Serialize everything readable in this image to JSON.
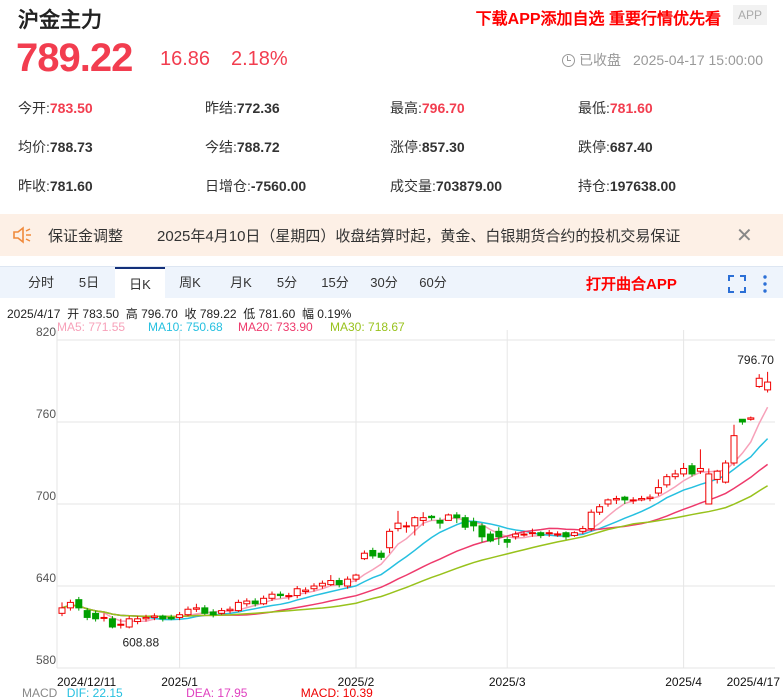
{
  "header": {
    "title": "沪金主力",
    "promo": "下载APP添加自选 重要行情优先看",
    "app_badge": "APP"
  },
  "quote": {
    "price": "789.22",
    "change": "16.86",
    "change_pct": "2.18%",
    "status": "已收盘",
    "datetime": "2025-04-17 15:00:00"
  },
  "stats": [
    [
      {
        "label": "今开:",
        "value": "783.50",
        "red": true
      },
      {
        "label": "昨结:",
        "value": "772.36"
      },
      {
        "label": "最高:",
        "value": "796.70",
        "red": true
      },
      {
        "label": "最低:",
        "value": "781.60",
        "red": true
      }
    ],
    [
      {
        "label": "均价:",
        "value": "788.73"
      },
      {
        "label": "今结:",
        "value": "788.72"
      },
      {
        "label": "涨停:",
        "value": "857.30"
      },
      {
        "label": "跌停:",
        "value": "687.40"
      }
    ],
    [
      {
        "label": "昨收:",
        "value": "781.60"
      },
      {
        "label": "日增仓:",
        "value": "-7560.00"
      },
      {
        "label": "成交量:",
        "value": "703879.00"
      },
      {
        "label": "持仓:",
        "value": "197638.00"
      }
    ]
  ],
  "notice": {
    "title": "保证金调整",
    "text": "2025年4月10日（星期四）收盘结算时起，黄金、白银期货合约的投机交易保证"
  },
  "tabs": [
    "分时",
    "5日",
    "日K",
    "周K",
    "月K",
    "5分",
    "15分",
    "30分",
    "60分"
  ],
  "active_tab": 2,
  "open_app": "打开曲合APP",
  "ohlc_info": {
    "date": "2025/4/17",
    "open": "开 783.50",
    "high": "高 796.70",
    "close": "收 789.22",
    "low": "低 781.60",
    "amp": "幅 0.19%"
  },
  "ma_info": {
    "ma5": "MA5: 771.55",
    "ma10": "MA10: 750.68",
    "ma20": "MA20: 733.90",
    "ma30": "MA30: 718.67"
  },
  "macd_info": {
    "label": "MACD",
    "dif": "DIF: 22.15",
    "dea": "DEA: 17.95",
    "macd": "MACD: 10.39"
  },
  "colors": {
    "up": "#f00000",
    "down": "#00a000",
    "ma5": "#f7a1b9",
    "ma10": "#26c0e0",
    "ma20": "#ee3a6c",
    "ma30": "#98c21c"
  },
  "chart_data": {
    "type": "candlestick",
    "ylim": [
      580,
      820
    ],
    "yticks": [
      "820",
      "760",
      "700",
      "640",
      "580"
    ],
    "xticks": [
      {
        "i": 0,
        "label": "2024/12/11"
      },
      {
        "i": 14,
        "label": "2025/1"
      },
      {
        "i": 35,
        "label": "2025/2"
      },
      {
        "i": 53,
        "label": "2025/3"
      },
      {
        "i": 74,
        "label": "2025/4"
      },
      {
        "i": 84,
        "label": "2025/4/17"
      }
    ],
    "max_label": "796.70",
    "min_label": "608.88",
    "candles": [
      [
        620,
        624,
        628,
        618
      ],
      [
        624,
        628,
        630,
        622
      ],
      [
        630,
        624,
        632,
        622
      ],
      [
        622,
        617,
        624,
        615
      ],
      [
        620,
        616,
        622,
        614
      ],
      [
        617,
        617,
        620,
        614
      ],
      [
        616,
        610,
        618,
        609
      ],
      [
        612,
        612,
        616,
        608.88
      ],
      [
        610,
        616,
        618,
        609
      ],
      [
        614,
        616,
        618,
        612
      ],
      [
        616,
        617,
        619,
        614
      ],
      [
        617,
        618,
        620,
        615
      ],
      [
        618,
        616,
        619,
        614
      ],
      [
        617,
        616,
        619,
        615
      ],
      [
        617,
        619,
        621,
        615
      ],
      [
        619,
        623,
        625,
        618
      ],
      [
        623,
        624,
        627,
        621
      ],
      [
        624,
        620,
        626,
        619
      ],
      [
        621,
        619,
        623,
        617
      ],
      [
        620,
        622,
        624,
        619
      ],
      [
        622,
        623,
        625,
        620
      ],
      [
        622,
        628,
        630,
        621
      ],
      [
        627,
        629,
        631,
        625
      ],
      [
        629,
        627,
        631,
        625
      ],
      [
        627,
        631,
        633,
        626
      ],
      [
        631,
        634,
        636,
        629
      ],
      [
        634,
        633,
        636,
        631
      ],
      [
        633,
        633,
        635,
        630
      ],
      [
        633,
        638,
        640,
        631
      ],
      [
        636,
        637,
        639,
        634
      ],
      [
        638,
        640,
        642,
        636
      ],
      [
        640,
        642,
        644,
        638
      ],
      [
        641,
        644,
        648,
        640
      ],
      [
        644,
        641,
        646,
        639
      ],
      [
        640,
        645,
        647,
        638
      ],
      [
        645,
        648,
        649,
        643
      ],
      [
        660,
        664,
        666,
        659
      ],
      [
        666,
        662,
        668,
        660
      ],
      [
        664,
        661,
        666,
        659
      ],
      [
        668,
        680,
        682,
        664
      ],
      [
        682,
        686,
        695,
        680
      ],
      [
        684,
        684,
        687,
        679
      ],
      [
        684,
        690,
        691,
        677
      ],
      [
        688,
        690,
        694,
        684
      ],
      [
        691,
        690,
        692,
        688
      ],
      [
        688,
        686,
        690,
        682
      ],
      [
        688,
        692,
        693,
        688
      ],
      [
        692,
        690,
        694,
        686
      ],
      [
        690,
        683,
        692,
        681
      ],
      [
        687,
        684,
        690,
        680
      ],
      [
        684,
        676,
        686,
        672
      ],
      [
        678,
        673,
        680,
        672
      ],
      [
        680,
        676,
        683,
        670
      ],
      [
        674,
        672,
        676,
        668
      ],
      [
        676,
        678,
        680,
        674
      ],
      [
        678,
        678,
        680,
        676
      ],
      [
        679,
        679,
        682,
        676
      ],
      [
        679,
        677,
        680,
        675
      ],
      [
        679,
        679,
        681,
        676
      ],
      [
        678,
        678,
        680,
        676
      ],
      [
        679,
        676,
        680,
        674
      ],
      [
        677,
        679,
        680,
        676
      ],
      [
        680,
        682,
        684,
        678
      ],
      [
        682,
        694,
        696,
        680
      ],
      [
        694,
        698,
        700,
        692
      ],
      [
        700,
        703,
        704,
        698
      ],
      [
        703,
        704,
        706,
        700
      ],
      [
        705,
        703,
        706,
        700
      ],
      [
        703,
        703,
        705,
        700
      ],
      [
        703,
        704,
        706,
        702
      ],
      [
        704,
        705,
        707,
        702
      ],
      [
        708,
        712,
        718,
        706
      ],
      [
        714,
        720,
        722,
        712
      ],
      [
        720,
        722,
        725,
        718
      ],
      [
        722,
        726,
        730,
        720
      ],
      [
        728,
        722,
        730,
        720
      ],
      [
        724,
        726,
        740,
        722
      ],
      [
        700,
        722,
        726,
        700
      ],
      [
        718,
        724,
        725,
        715
      ],
      [
        716,
        730,
        732,
        715
      ],
      [
        730,
        750,
        758,
        728
      ],
      [
        762,
        760,
        762,
        758
      ],
      [
        762,
        763,
        764,
        761
      ],
      [
        786,
        792,
        795,
        785
      ],
      [
        783.5,
        789.22,
        796.7,
        781.6
      ]
    ]
  }
}
